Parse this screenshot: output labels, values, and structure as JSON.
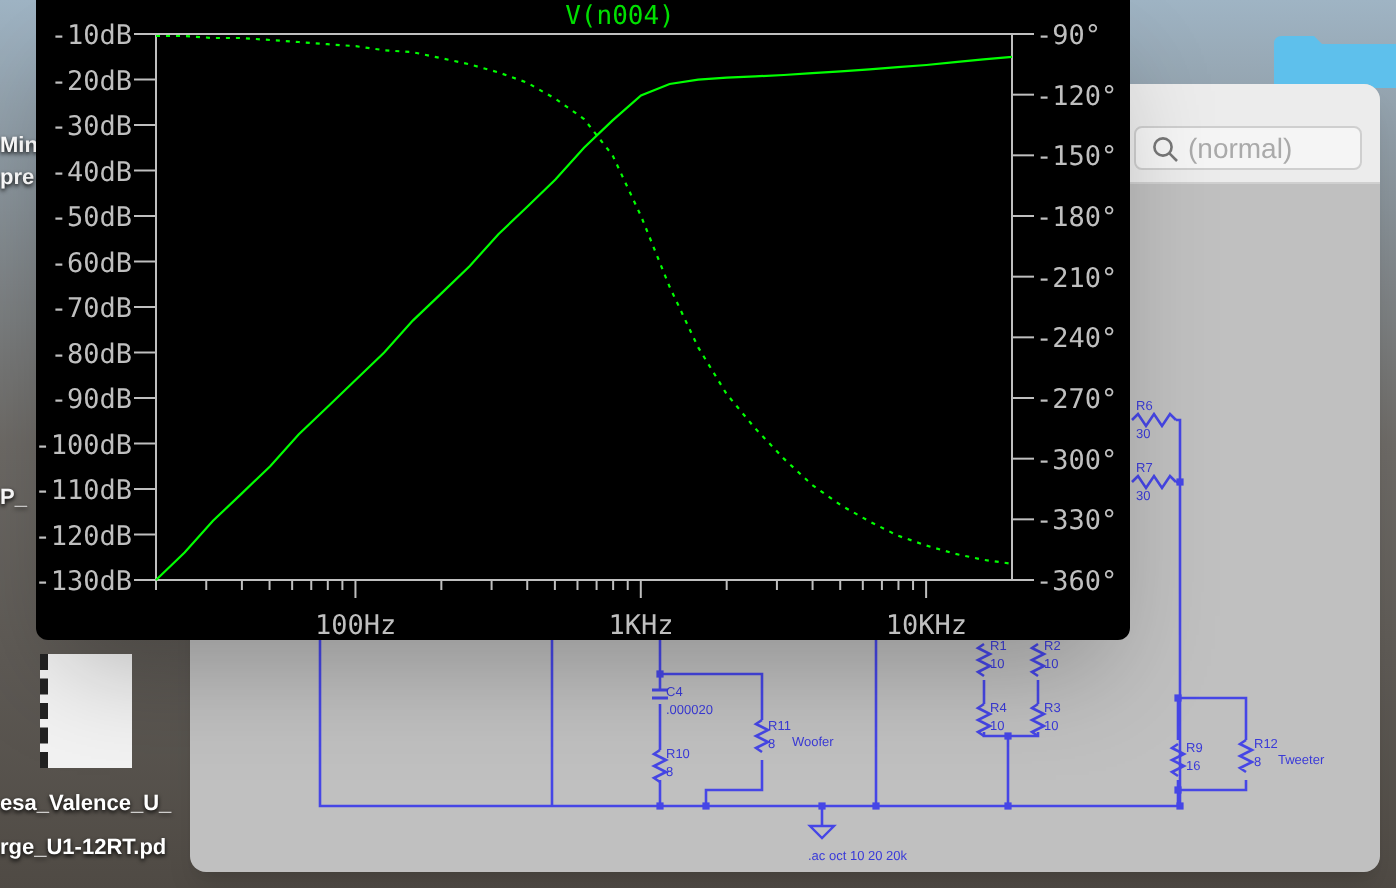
{
  "desktop": {
    "labels": [
      {
        "text": "Min"
      },
      {
        "text": "pre"
      },
      {
        "text": "P_"
      },
      {
        "text": "esa_Valence_U_"
      },
      {
        "text": "rge_U1-12RT.pd"
      }
    ]
  },
  "schematic_window": {
    "search": {
      "placeholder": "(normal)"
    },
    "components": [
      {
        "kind": "resistor",
        "name": "R6",
        "value": "30"
      },
      {
        "kind": "resistor",
        "name": "R7",
        "value": "30"
      },
      {
        "kind": "resistor",
        "name": "R1",
        "value": "10"
      },
      {
        "kind": "resistor",
        "name": "R2",
        "value": "10"
      },
      {
        "kind": "resistor",
        "name": "R4",
        "value": "10"
      },
      {
        "kind": "resistor",
        "name": "R3",
        "value": "10"
      },
      {
        "kind": "capacitor",
        "name": "C4",
        "value": ".000020"
      },
      {
        "kind": "resistor",
        "name": "R10",
        "value": "8"
      },
      {
        "kind": "resistor",
        "name": "R11",
        "value": "8",
        "tag": "Woofer"
      },
      {
        "kind": "resistor",
        "name": "R9",
        "value": "16"
      },
      {
        "kind": "resistor",
        "name": "R12",
        "value": "8",
        "tag": "Tweeter"
      }
    ],
    "directive": ".ac oct 10 20 20k"
  },
  "plot_window": {
    "chart_data": {
      "type": "line",
      "title": "V(n004)",
      "categories": [
        null,
        null,
        null,
        null,
        null,
        null,
        null,
        "100Hz",
        null,
        null,
        null,
        null,
        null,
        null,
        null,
        null,
        null,
        "1KHz",
        null,
        null,
        null,
        null,
        null,
        null,
        null,
        null,
        null,
        "10KHz",
        null,
        null,
        null
      ],
      "series": [
        {
          "color": "#00ff00",
          "values": [
            -130,
            -124,
            -117,
            -111,
            -105,
            -98,
            -92,
            -86,
            -80,
            -73,
            -67,
            -61,
            -54,
            -48,
            -42,
            -35,
            -29,
            -23.5,
            -21,
            -20,
            -19.6,
            -19.3,
            -19,
            -18.6,
            -18.2,
            -17.8,
            -17.3,
            -16.8,
            -16.2,
            -15.6,
            -15
          ]
        },
        {
          "color": "#00ff00",
          "axis": "y2",
          "line_style": "dashed",
          "values": [
            -91,
            -91,
            -92,
            -92,
            -93,
            -94,
            -95,
            -96,
            -98,
            -99,
            -102,
            -105,
            -109,
            -114,
            -122,
            -132,
            -150,
            -180,
            -215,
            -245,
            -268,
            -285,
            -300,
            -313,
            -323,
            -331,
            -338,
            -343,
            -347,
            -350,
            -352
          ]
        }
      ],
      "ylim": [
        -130,
        -10
      ],
      "y2lim": [
        -360,
        -90
      ],
      "yticks": [
        {
          "value": -10,
          "label": "-10dB"
        },
        {
          "value": -20,
          "label": "-20dB"
        },
        {
          "value": -30,
          "label": "-30dB"
        },
        {
          "value": -40,
          "label": "-40dB"
        },
        {
          "value": -50,
          "label": "-50dB"
        },
        {
          "value": -60,
          "label": "-60dB"
        },
        {
          "value": -70,
          "label": "-70dB"
        },
        {
          "value": -80,
          "label": "-80dB"
        },
        {
          "value": -90,
          "label": "-90dB"
        },
        {
          "value": -100,
          "label": "-100dB"
        },
        {
          "value": -110,
          "label": "-110dB"
        },
        {
          "value": -120,
          "label": "-120dB"
        },
        {
          "value": -130,
          "label": "-130dB"
        }
      ],
      "y2ticks": [
        {
          "value": -90,
          "label": "-90°"
        },
        {
          "value": -120,
          "label": "-120°"
        },
        {
          "value": -150,
          "label": "-150°"
        },
        {
          "value": -180,
          "label": "-180°"
        },
        {
          "value": -210,
          "label": "-210°"
        },
        {
          "value": -240,
          "label": "-240°"
        },
        {
          "value": -270,
          "label": "-270°"
        },
        {
          "value": -300,
          "label": "-300°"
        },
        {
          "value": -330,
          "label": "-330°"
        },
        {
          "value": -360,
          "label": "-360°"
        }
      ]
    }
  }
}
